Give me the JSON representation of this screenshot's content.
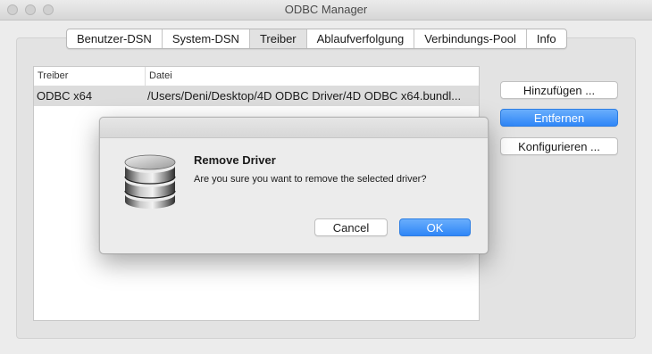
{
  "window": {
    "title": "ODBC Manager"
  },
  "tabs": [
    {
      "label": "Benutzer-DSN",
      "active": false
    },
    {
      "label": "System-DSN",
      "active": false
    },
    {
      "label": "Treiber",
      "active": true
    },
    {
      "label": "Ablaufverfolgung",
      "active": false
    },
    {
      "label": "Verbindungs-Pool",
      "active": false
    },
    {
      "label": "Info",
      "active": false
    }
  ],
  "table": {
    "columns": [
      "Treiber",
      "Datei"
    ],
    "rows": [
      {
        "driver": "ODBC x64",
        "file": "/Users/Deni/Desktop/4D ODBC Driver/4D ODBC x64.bundl..."
      }
    ]
  },
  "side_buttons": {
    "add": "Hinzufügen ...",
    "remove": "Entfernen",
    "configure": "Konfigurieren ..."
  },
  "dialog": {
    "title": "Remove Driver",
    "message": "Are you sure you want to remove the selected driver?",
    "cancel": "Cancel",
    "ok": "OK",
    "icon": "database-icon"
  },
  "colors": {
    "accent": "#3b8ff8",
    "selection_row": "#dcdcdc"
  }
}
